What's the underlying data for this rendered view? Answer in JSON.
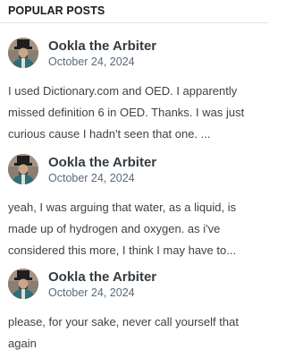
{
  "widget": {
    "title": "POPULAR POSTS"
  },
  "posts": [
    {
      "author": "Ookla the Arbiter",
      "date": "October 24, 2024",
      "avatar_icon": "user-avatar-icon",
      "excerpt_lines": [
        "I used Dictionary.com and OED. I apparently",
        "missed definition 6 in OED. Thanks. I was just",
        "curious cause I hadn't seen that one. ..."
      ]
    },
    {
      "author": "Ookla the Arbiter",
      "date": "October 24, 2024",
      "avatar_icon": "user-avatar-icon",
      "excerpt_lines": [
        "yeah, I was arguing that water, as a liquid, is",
        "made up of hydrogen and oxygen. as i've",
        "considered this more, I think I may have to..."
      ]
    },
    {
      "author": "Ookla the Arbiter",
      "date": "October 24, 2024",
      "avatar_icon": "user-avatar-icon",
      "excerpt_lines": [
        "please, for your sake, never call yourself that",
        "again"
      ]
    }
  ],
  "colors": {
    "title": "#1b1b1b",
    "author": "#353c41",
    "date": "#5b6a78",
    "text": "#3d4247",
    "divider": "#e2e3e6"
  }
}
